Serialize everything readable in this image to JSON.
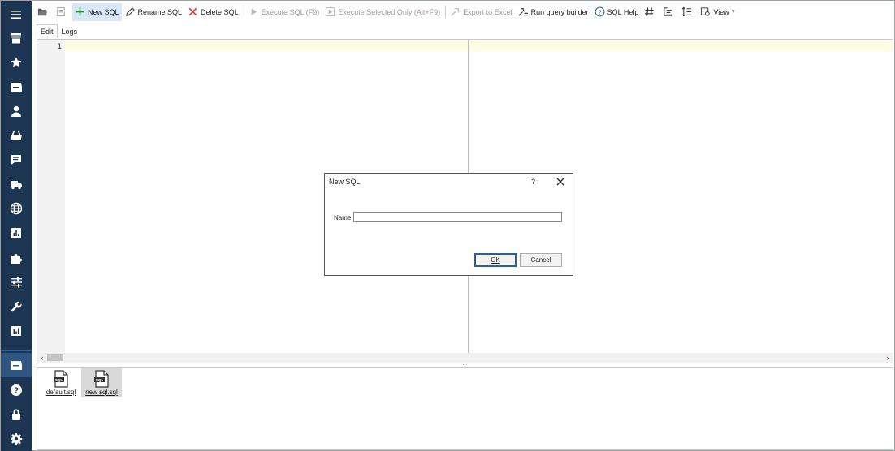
{
  "toolbar": {
    "new_sql": "New SQL",
    "rename_sql": "Rename SQL",
    "delete_sql": "Delete SQL",
    "execute_sql": "Execute SQL (F9)",
    "execute_selected": "Execute Selected Only (Alt+F9)",
    "export_excel": "Export to Excel",
    "run_query_builder": "Run query builder",
    "sql_help": "SQL Help",
    "view": "View"
  },
  "tabs": [
    {
      "label": "Edit",
      "active": true
    },
    {
      "label": "Logs",
      "active": false
    }
  ],
  "editor": {
    "line_numbers": [
      "1"
    ]
  },
  "files": [
    {
      "name": "default.sql",
      "selected": false
    },
    {
      "name": "new sql.sql",
      "selected": true
    }
  ],
  "dialog": {
    "title": "New SQL",
    "help": "?",
    "name_label": "Name",
    "name_value": "",
    "ok_label": "OK",
    "cancel_label": "Cancel"
  },
  "colors": {
    "sidebar_bg": "#1b3552",
    "accent": "#2b5f9a",
    "highlight": "#d9e8f6"
  },
  "sidebar": {
    "icons": [
      "menu-icon",
      "store-icon",
      "star-icon",
      "archive-icon",
      "user-icon",
      "basket-icon",
      "chat-icon",
      "truck-icon",
      "globe-icon",
      "chart-icon",
      "puzzle-icon",
      "sliders-icon",
      "wrench-icon",
      "report-icon",
      "database-icon",
      "help-icon",
      "lock-icon",
      "gear-icon"
    ]
  }
}
